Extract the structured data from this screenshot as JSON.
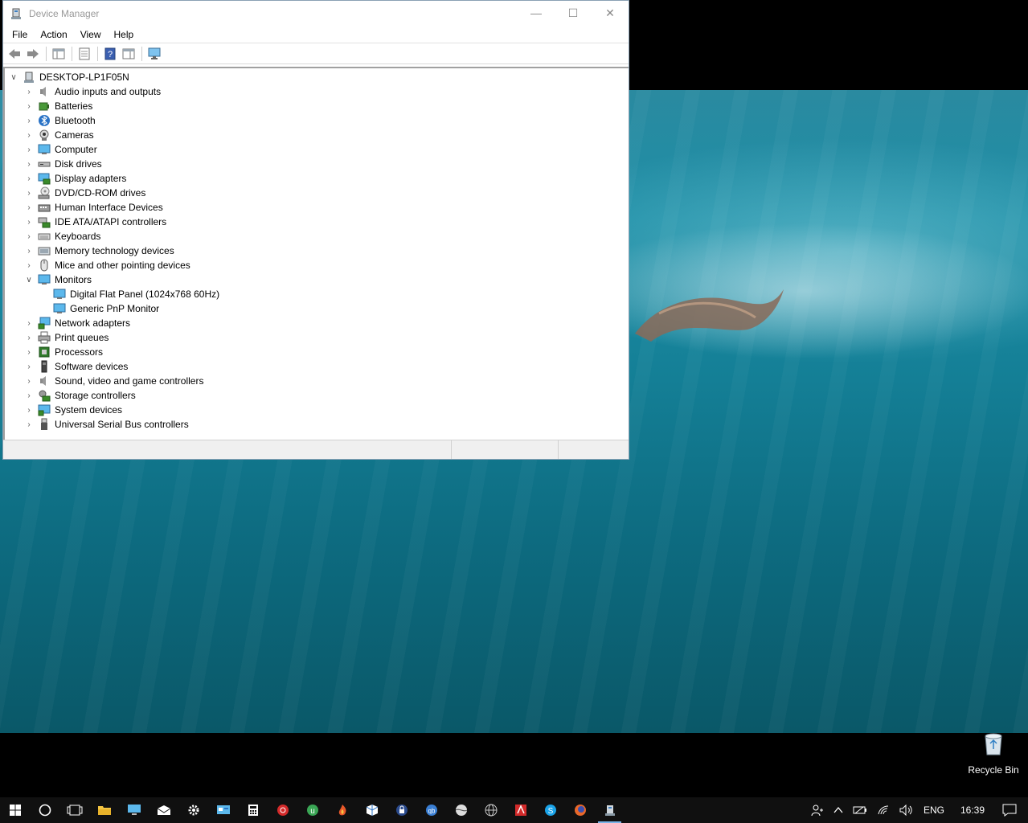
{
  "window": {
    "title": "Device Manager",
    "controls": {
      "minimize": "—",
      "maximize": "☐",
      "close": "✕"
    }
  },
  "menu": [
    "File",
    "Action",
    "View",
    "Help"
  ],
  "toolbar_icons": [
    "back-arrow-icon",
    "forward-arrow-icon",
    "show-hide-console-tree-icon",
    "properties-icon",
    "help-icon",
    "action-pane-icon",
    "scan-hardware-icon"
  ],
  "tree": {
    "root": "DESKTOP-LP1F05N",
    "items": [
      {
        "label": "Audio inputs and outputs",
        "icon": "speaker-icon",
        "expanded": false
      },
      {
        "label": "Batteries",
        "icon": "battery-icon",
        "expanded": false
      },
      {
        "label": "Bluetooth",
        "icon": "bluetooth-icon",
        "expanded": false
      },
      {
        "label": "Cameras",
        "icon": "camera-icon",
        "expanded": false
      },
      {
        "label": "Computer",
        "icon": "computer-icon",
        "expanded": false
      },
      {
        "label": "Disk drives",
        "icon": "disk-drive-icon",
        "expanded": false
      },
      {
        "label": "Display adapters",
        "icon": "display-adapter-icon",
        "expanded": false
      },
      {
        "label": "DVD/CD-ROM drives",
        "icon": "dvd-icon",
        "expanded": false
      },
      {
        "label": "Human Interface Devices",
        "icon": "hid-icon",
        "expanded": false
      },
      {
        "label": "IDE ATA/ATAPI controllers",
        "icon": "ide-controller-icon",
        "expanded": false
      },
      {
        "label": "Keyboards",
        "icon": "keyboard-icon",
        "expanded": false
      },
      {
        "label": "Memory technology devices",
        "icon": "memory-icon",
        "expanded": false
      },
      {
        "label": "Mice and other pointing devices",
        "icon": "mouse-icon",
        "expanded": false
      },
      {
        "label": "Monitors",
        "icon": "monitor-icon",
        "expanded": true,
        "children": [
          {
            "label": "Digital Flat Panel (1024x768 60Hz)",
            "icon": "monitor-icon"
          },
          {
            "label": "Generic PnP Monitor",
            "icon": "monitor-icon"
          }
        ]
      },
      {
        "label": "Network adapters",
        "icon": "network-adapter-icon",
        "expanded": false
      },
      {
        "label": "Print queues",
        "icon": "printer-icon",
        "expanded": false
      },
      {
        "label": "Processors",
        "icon": "processor-icon",
        "expanded": false
      },
      {
        "label": "Software devices",
        "icon": "software-device-icon",
        "expanded": false
      },
      {
        "label": "Sound, video and game controllers",
        "icon": "sound-controller-icon",
        "expanded": false
      },
      {
        "label": "Storage controllers",
        "icon": "storage-controller-icon",
        "expanded": false
      },
      {
        "label": "System devices",
        "icon": "system-device-icon",
        "expanded": false
      },
      {
        "label": "Universal Serial Bus controllers",
        "icon": "usb-icon",
        "expanded": false
      }
    ]
  },
  "desktop": {
    "recycle_bin_label": "Recycle Bin"
  },
  "taskbar": {
    "apps": [
      "start-icon",
      "cortana-icon",
      "task-view-icon",
      "file-explorer-icon",
      "this-pc-icon",
      "mail-icon",
      "settings-icon",
      "control-panel-icon",
      "calculator-icon",
      "app-red-icon",
      "utorrent-icon",
      "app-flame-icon",
      "virtualbox-icon",
      "vpn-icon",
      "qbittorrent-icon",
      "app-disc-icon",
      "app-globe-icon",
      "acrobat-icon",
      "skype-icon",
      "firefox-icon",
      "device-manager-taskbar-icon"
    ],
    "active_app": "device-manager-taskbar-icon",
    "tray": {
      "language": "ENG",
      "time": "16:39"
    }
  },
  "colors": {
    "accent": "#7ab4e8",
    "taskbar": "#101010",
    "wallpaper_water": "#147f96"
  }
}
